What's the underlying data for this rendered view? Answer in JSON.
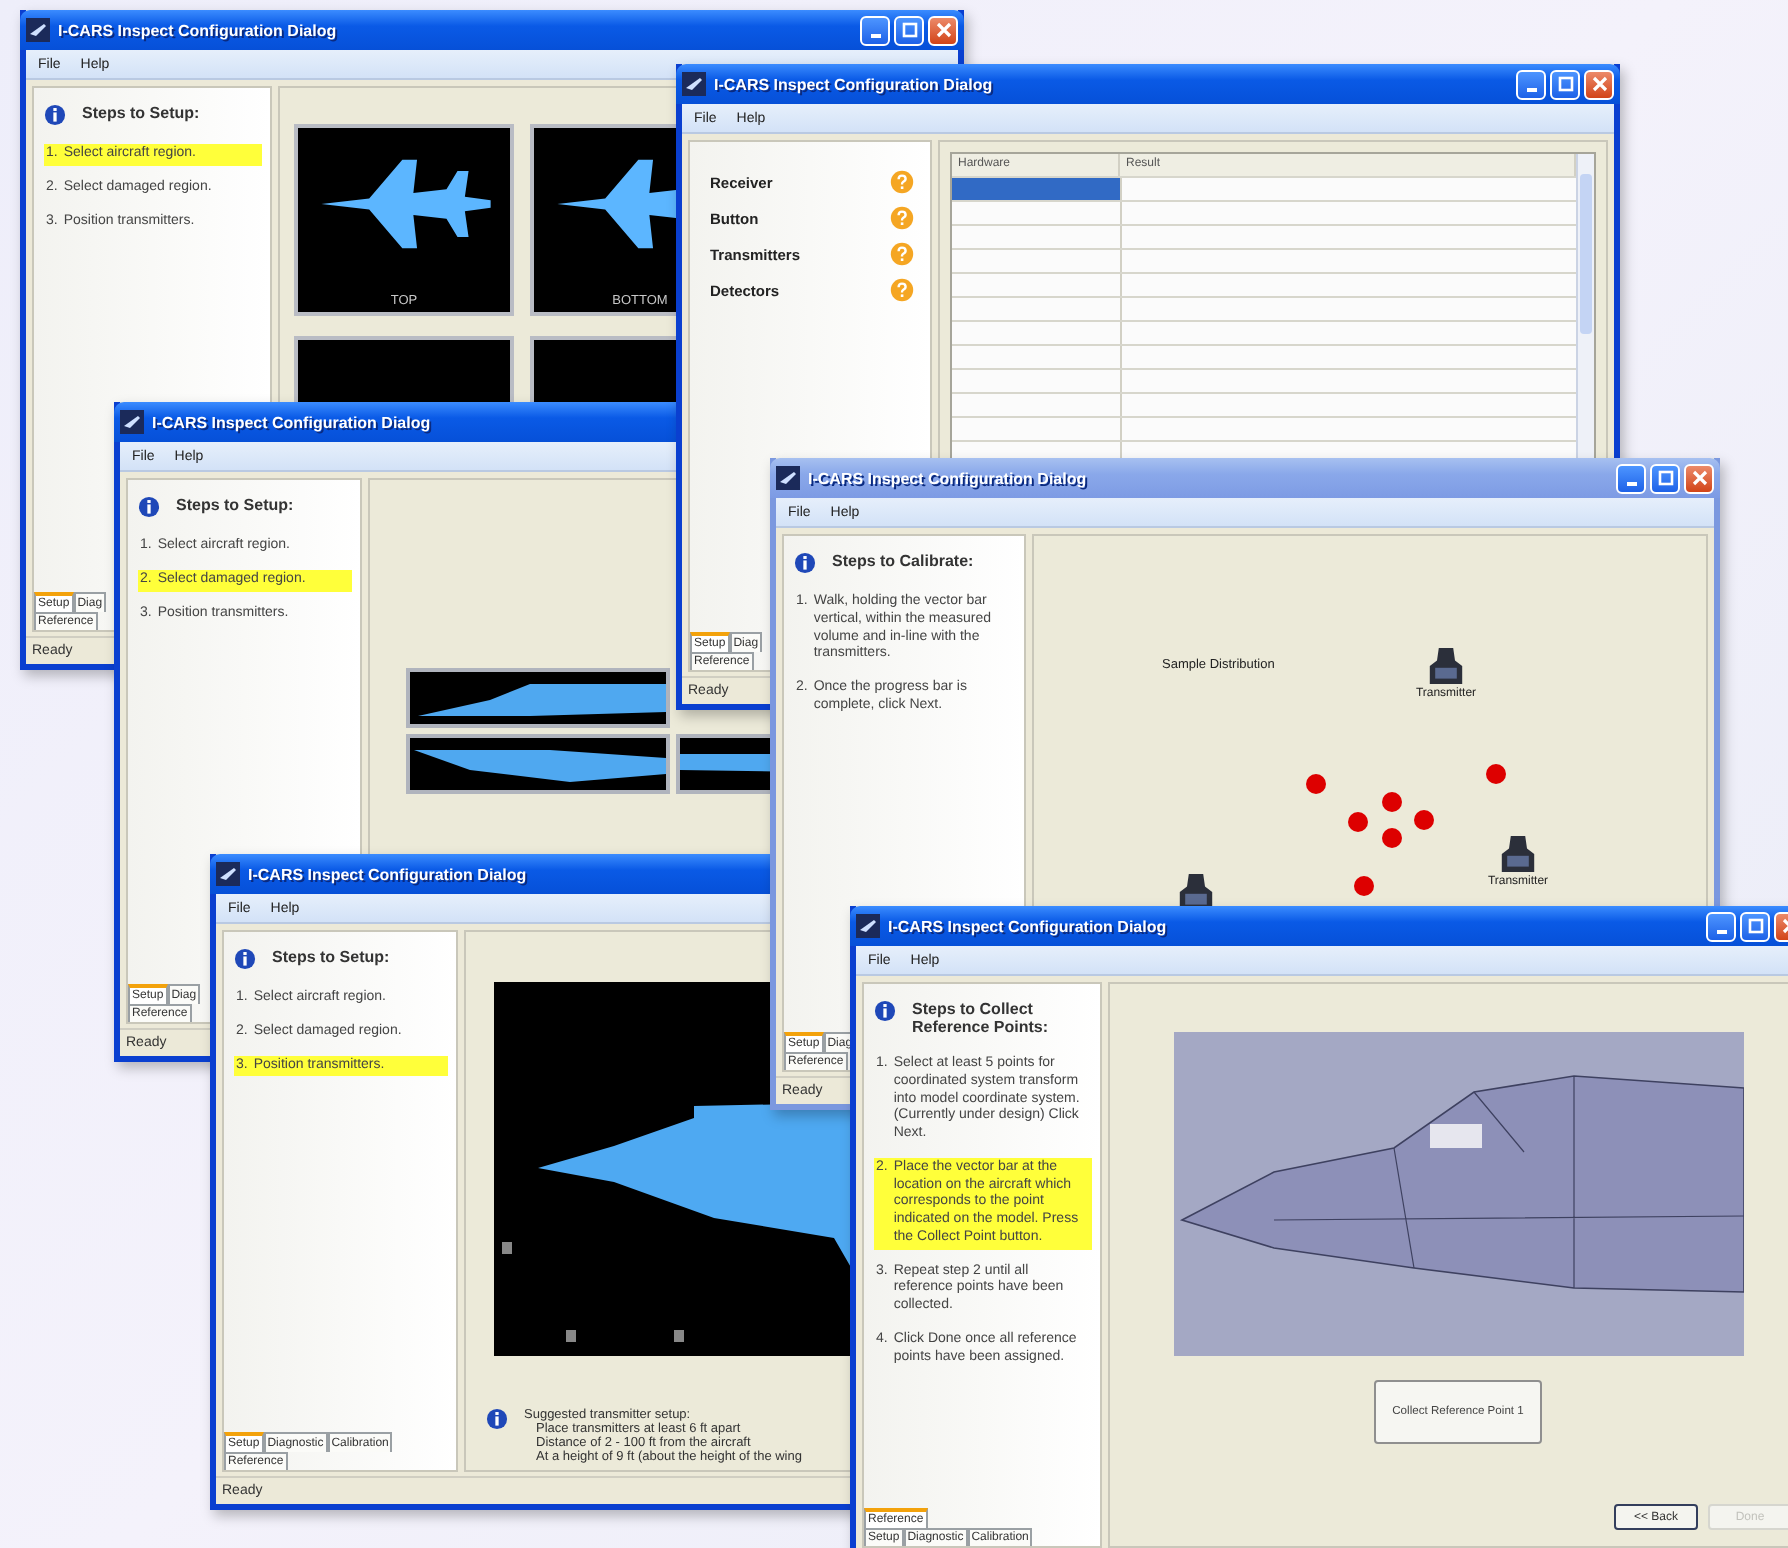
{
  "windows": [
    {
      "title": "I-CARS Inspect Configuration Dialog",
      "active": true,
      "menu": [
        "File",
        "Help"
      ],
      "sidebar": {
        "kind": "steps",
        "heading": "Steps to Setup:",
        "steps": [
          {
            "number": "1.",
            "text": "Select aircraft region.",
            "selected": true
          },
          {
            "number": "2.",
            "text": "Select damaged region.",
            "selected": false
          },
          {
            "number": "3.",
            "text": "Position transmitters.",
            "selected": false
          }
        ]
      },
      "tab_rows": [
        [
          {
            "label": "Setup",
            "selected": true
          },
          {
            "label": "Diag",
            "selected": false
          }
        ],
        [
          {
            "label": "Reference",
            "selected": false
          }
        ]
      ],
      "status": "Ready",
      "content": {
        "kind": "thumbnails",
        "thumbnails": [
          {
            "kind": "captioned",
            "caption": "TOP"
          },
          {
            "kind": "captioned",
            "caption": "BOTTOM"
          },
          {
            "kind": "blank"
          },
          {
            "kind": "blank"
          }
        ]
      }
    },
    {
      "title": "I-CARS Inspect Configuration Dialog",
      "active": true,
      "menu": [
        "File",
        "Help"
      ],
      "sidebar": {
        "kind": "steps",
        "heading": "Steps to Setup:",
        "steps": [
          {
            "number": "1.",
            "text": "Select aircraft region.",
            "selected": false
          },
          {
            "number": "2.",
            "text": "Select damaged region.",
            "selected": true
          },
          {
            "number": "3.",
            "text": "Position transmitters.",
            "selected": false
          }
        ]
      },
      "tab_rows": [
        [
          {
            "label": "Setup",
            "selected": true
          },
          {
            "label": "Diag",
            "selected": false
          }
        ],
        [
          {
            "label": "Reference",
            "selected": false
          }
        ]
      ],
      "status": "Ready",
      "content": {
        "kind": "side_views"
      }
    },
    {
      "title": "I-CARS Inspect Configuration Dialog",
      "active": true,
      "menu": [
        "File",
        "Help"
      ],
      "sidebar": {
        "kind": "hardware",
        "items": [
          {
            "label": "Receiver"
          },
          {
            "label": "Button"
          },
          {
            "label": "Transmitters"
          },
          {
            "label": "Detectors"
          }
        ]
      },
      "tab_rows": [
        [
          {
            "label": "Setup",
            "selected": true
          },
          {
            "label": "Diag",
            "selected": false
          }
        ],
        [
          {
            "label": "Reference",
            "selected": false
          }
        ]
      ],
      "status": "Ready",
      "content": {
        "kind": "table",
        "columns": [
          "Hardware",
          "Result"
        ],
        "rows": [
          {
            "selected": true
          },
          {
            "selected": false
          },
          {
            "selected": false
          },
          {
            "selected": false
          },
          {
            "selected": false
          },
          {
            "selected": false
          },
          {
            "selected": false
          },
          {
            "selected": false
          },
          {
            "selected": false
          },
          {
            "selected": false
          },
          {
            "selected": false
          },
          {
            "selected": false
          }
        ]
      }
    },
    {
      "title": "I-CARS Inspect Configuration Dialog",
      "active": true,
      "menu": [
        "File",
        "Help"
      ],
      "sidebar": {
        "kind": "steps",
        "heading": "Steps to Setup:",
        "steps": [
          {
            "number": "1.",
            "text": "Select aircraft region.",
            "selected": false
          },
          {
            "number": "2.",
            "text": "Select damaged region.",
            "selected": false
          },
          {
            "number": "3.",
            "text": "Position transmitters.",
            "selected": true
          }
        ]
      },
      "tab_rows": [
        [
          {
            "label": "Setup",
            "selected": true
          },
          {
            "label": "Diagnostic",
            "selected": false
          },
          {
            "label": "Calibration",
            "selected": false
          }
        ],
        [
          {
            "label": "Reference",
            "selected": false
          }
        ]
      ],
      "status": "Ready",
      "content": {
        "kind": "setup_view",
        "note_heading": "Suggested transmitter setup:",
        "note_lines": [
          "Place transmitters at least 6 ft apart",
          "Distance of 2 - 100 ft from the aircraft",
          "At a height of 9 ft (about the height of the wing"
        ]
      }
    },
    {
      "title": "I-CARS Inspect Configuration Dialog",
      "active": false,
      "menu": [
        "File",
        "Help"
      ],
      "sidebar": {
        "kind": "steps",
        "heading": "Steps to Calibrate:",
        "steps": [
          {
            "number": "1.",
            "text": "Walk, holding the vector bar vertical, within the measured volume and in-line with the transmitters.",
            "selected": false
          },
          {
            "number": "2.",
            "text": "Once the progress bar is complete, click Next.",
            "selected": false
          }
        ]
      },
      "tab_rows": [
        [
          {
            "label": "Setup",
            "selected": true
          },
          {
            "label": "Diag",
            "selected": false
          }
        ],
        [
          {
            "label": "Reference",
            "selected": false
          }
        ]
      ],
      "status": "Ready",
      "content": {
        "kind": "calibration",
        "caption": "Sample Distribution",
        "transmitters": [
          {
            "label": "Transmitter"
          },
          {
            "label": "Transmitter"
          }
        ]
      }
    },
    {
      "title": "I-CARS Inspect Configuration Dialog",
      "active": true,
      "menu": [
        "File",
        "Help"
      ],
      "sidebar": {
        "kind": "steps",
        "heading": "Steps to Collect Reference Points:",
        "steps": [
          {
            "number": "1.",
            "text": "Select at least 5 points for coordinated system transform into model coordinate system. (Currently under design) Click Next.",
            "selected": false
          },
          {
            "number": "2.",
            "text": "Place the vector bar at the location on the aircraft which corresponds to the point indicated on the model. Press the Collect Point button.",
            "selected": true
          },
          {
            "number": "3.",
            "text": "Repeat step 2 until all reference points have been collected.",
            "selected": false
          },
          {
            "number": "4.",
            "text": "Click Done once all reference points have been assigned.",
            "selected": false
          }
        ]
      },
      "tab_rows": [
        [
          {
            "label": "Reference",
            "selected": true
          }
        ],
        [
          {
            "label": "Setup",
            "selected": false
          },
          {
            "label": "Diagnostic",
            "selected": false
          },
          {
            "label": "Calibration",
            "selected": false
          }
        ]
      ],
      "content": {
        "kind": "reference",
        "collect_button": "Collect Reference Point 1",
        "nav_buttons": [
          {
            "label": "<< Back",
            "disabled": false
          },
          {
            "label": "Done",
            "disabled": true
          }
        ]
      }
    }
  ]
}
